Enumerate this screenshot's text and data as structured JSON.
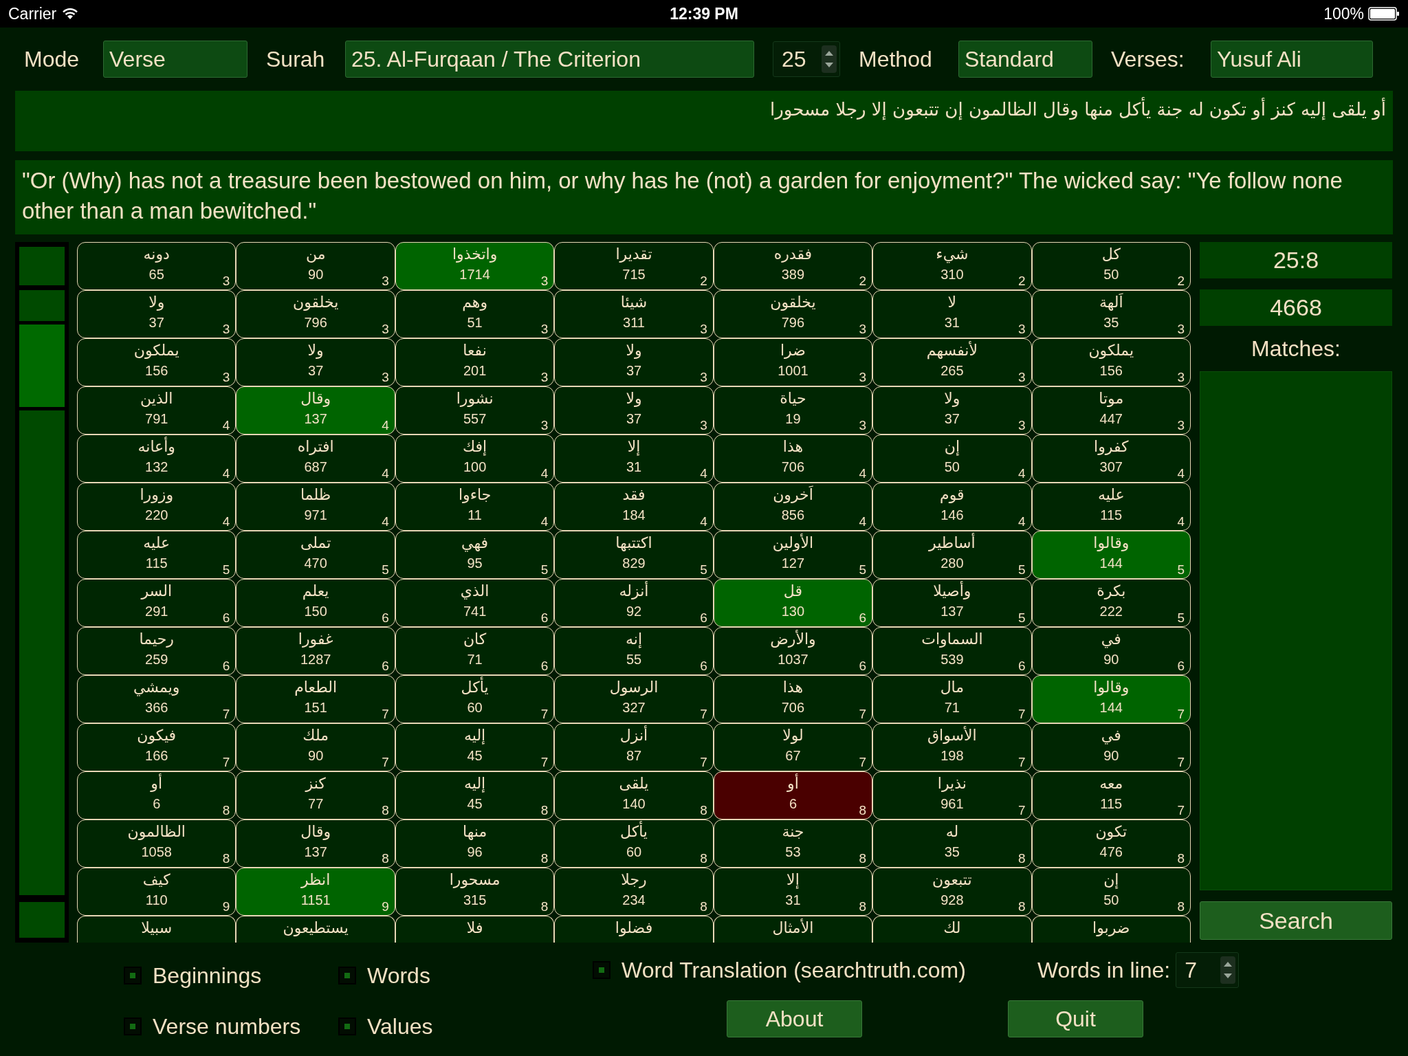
{
  "status_bar": {
    "carrier": "Carrier",
    "time": "12:39 PM",
    "battery": "100%"
  },
  "toolbar": {
    "mode_label": "Mode",
    "mode": "Verse",
    "surah_label": "Surah",
    "surah": "25. Al-Furqaan / The Criterion",
    "surah_number": "25",
    "method_label": "Method",
    "method": "Standard",
    "verses_label": "Verses:",
    "verses": "Yusuf Ali"
  },
  "arabic_verse": "أو يلقى إليه كنز أو تكون له جنة يأكل منها وقال الظالمون إن تتبعون إلا رجلا مسحورا",
  "translation": "\"Or (Why) has not a treasure been bestowed on him, or why has he (not) a garden for enjoyment?\" The wicked say: \"Ye follow none other than a man bewitched.\"",
  "grid": {
    "rows": [
      [
        {
          "word": "كل",
          "value": "50",
          "verse": "2",
          "kind": "plain"
        },
        {
          "word": "شيء",
          "value": "310",
          "verse": "2",
          "kind": "plain"
        },
        {
          "word": "فقدره",
          "value": "389",
          "verse": "2",
          "kind": "plain"
        },
        {
          "word": "تقديرا",
          "value": "715",
          "verse": "2",
          "kind": "plain"
        },
        {
          "word": "واتخذوا",
          "value": "1714",
          "verse": "3",
          "kind": "match"
        },
        {
          "word": "من",
          "value": "90",
          "verse": "3",
          "kind": "plain"
        },
        {
          "word": "دونه",
          "value": "65",
          "verse": "3",
          "kind": "plain"
        }
      ],
      [
        {
          "word": "اَلهة",
          "value": "35",
          "verse": "3",
          "kind": "plain"
        },
        {
          "word": "لا",
          "value": "31",
          "verse": "3",
          "kind": "plain"
        },
        {
          "word": "يخلقون",
          "value": "796",
          "verse": "3",
          "kind": "plain"
        },
        {
          "word": "شيئا",
          "value": "311",
          "verse": "3",
          "kind": "plain"
        },
        {
          "word": "وهم",
          "value": "51",
          "verse": "3",
          "kind": "plain"
        },
        {
          "word": "يخلقون",
          "value": "796",
          "verse": "3",
          "kind": "plain"
        },
        {
          "word": "ولا",
          "value": "37",
          "verse": "3",
          "kind": "plain"
        }
      ],
      [
        {
          "word": "يملكون",
          "value": "156",
          "verse": "3",
          "kind": "plain"
        },
        {
          "word": "لأنفسهم",
          "value": "265",
          "verse": "3",
          "kind": "plain"
        },
        {
          "word": "ضرا",
          "value": "1001",
          "verse": "3",
          "kind": "plain"
        },
        {
          "word": "ولا",
          "value": "37",
          "verse": "3",
          "kind": "plain"
        },
        {
          "word": "نفعا",
          "value": "201",
          "verse": "3",
          "kind": "plain"
        },
        {
          "word": "ولا",
          "value": "37",
          "verse": "3",
          "kind": "plain"
        },
        {
          "word": "يملكون",
          "value": "156",
          "verse": "3",
          "kind": "plain"
        }
      ],
      [
        {
          "word": "موتا",
          "value": "447",
          "verse": "3",
          "kind": "plain"
        },
        {
          "word": "ولا",
          "value": "37",
          "verse": "3",
          "kind": "plain"
        },
        {
          "word": "حياة",
          "value": "19",
          "verse": "3",
          "kind": "plain"
        },
        {
          "word": "ولا",
          "value": "37",
          "verse": "3",
          "kind": "plain"
        },
        {
          "word": "نشورا",
          "value": "557",
          "verse": "3",
          "kind": "plain"
        },
        {
          "word": "وقال",
          "value": "137",
          "verse": "4",
          "kind": "match"
        },
        {
          "word": "الذين",
          "value": "791",
          "verse": "4",
          "kind": "plain"
        }
      ],
      [
        {
          "word": "كفروا",
          "value": "307",
          "verse": "4",
          "kind": "plain"
        },
        {
          "word": "إن",
          "value": "50",
          "verse": "4",
          "kind": "plain"
        },
        {
          "word": "هذا",
          "value": "706",
          "verse": "4",
          "kind": "plain"
        },
        {
          "word": "إلا",
          "value": "31",
          "verse": "4",
          "kind": "plain"
        },
        {
          "word": "إفك",
          "value": "100",
          "verse": "4",
          "kind": "plain"
        },
        {
          "word": "افتراه",
          "value": "687",
          "verse": "4",
          "kind": "plain"
        },
        {
          "word": "وأعانه",
          "value": "132",
          "verse": "4",
          "kind": "plain"
        }
      ],
      [
        {
          "word": "عليه",
          "value": "115",
          "verse": "4",
          "kind": "plain"
        },
        {
          "word": "قوم",
          "value": "146",
          "verse": "4",
          "kind": "plain"
        },
        {
          "word": "اَخرون",
          "value": "856",
          "verse": "4",
          "kind": "plain"
        },
        {
          "word": "فقد",
          "value": "184",
          "verse": "4",
          "kind": "plain"
        },
        {
          "word": "جاءوا",
          "value": "11",
          "verse": "4",
          "kind": "plain"
        },
        {
          "word": "ظلما",
          "value": "971",
          "verse": "4",
          "kind": "plain"
        },
        {
          "word": "وزورا",
          "value": "220",
          "verse": "4",
          "kind": "plain"
        }
      ],
      [
        {
          "word": "وقالوا",
          "value": "144",
          "verse": "5",
          "kind": "match"
        },
        {
          "word": "أساطير",
          "value": "280",
          "verse": "5",
          "kind": "plain"
        },
        {
          "word": "الأولين",
          "value": "127",
          "verse": "5",
          "kind": "plain"
        },
        {
          "word": "اكتتبها",
          "value": "829",
          "verse": "5",
          "kind": "plain"
        },
        {
          "word": "فهي",
          "value": "95",
          "verse": "5",
          "kind": "plain"
        },
        {
          "word": "تملى",
          "value": "470",
          "verse": "5",
          "kind": "plain"
        },
        {
          "word": "عليه",
          "value": "115",
          "verse": "5",
          "kind": "plain"
        }
      ],
      [
        {
          "word": "بكرة",
          "value": "222",
          "verse": "5",
          "kind": "plain"
        },
        {
          "word": "وأصيلا",
          "value": "137",
          "verse": "5",
          "kind": "plain"
        },
        {
          "word": "قل",
          "value": "130",
          "verse": "6",
          "kind": "match"
        },
        {
          "word": "أنزله",
          "value": "92",
          "verse": "6",
          "kind": "plain"
        },
        {
          "word": "الذي",
          "value": "741",
          "verse": "6",
          "kind": "plain"
        },
        {
          "word": "يعلم",
          "value": "150",
          "verse": "6",
          "kind": "plain"
        },
        {
          "word": "السر",
          "value": "291",
          "verse": "6",
          "kind": "plain"
        }
      ],
      [
        {
          "word": "في",
          "value": "90",
          "verse": "6",
          "kind": "plain"
        },
        {
          "word": "السماوات",
          "value": "539",
          "verse": "6",
          "kind": "plain"
        },
        {
          "word": "والأرض",
          "value": "1037",
          "verse": "6",
          "kind": "plain"
        },
        {
          "word": "إنه",
          "value": "55",
          "verse": "6",
          "kind": "plain"
        },
        {
          "word": "كان",
          "value": "71",
          "verse": "6",
          "kind": "plain"
        },
        {
          "word": "غفورا",
          "value": "1287",
          "verse": "6",
          "kind": "plain"
        },
        {
          "word": "رحيما",
          "value": "259",
          "verse": "6",
          "kind": "plain"
        }
      ],
      [
        {
          "word": "وقالوا",
          "value": "144",
          "verse": "7",
          "kind": "match"
        },
        {
          "word": "مال",
          "value": "71",
          "verse": "7",
          "kind": "plain"
        },
        {
          "word": "هذا",
          "value": "706",
          "verse": "7",
          "kind": "plain"
        },
        {
          "word": "الرسول",
          "value": "327",
          "verse": "7",
          "kind": "plain"
        },
        {
          "word": "يأكل",
          "value": "60",
          "verse": "7",
          "kind": "plain"
        },
        {
          "word": "الطعام",
          "value": "151",
          "verse": "7",
          "kind": "plain"
        },
        {
          "word": "ويمشي",
          "value": "366",
          "verse": "7",
          "kind": "plain"
        }
      ],
      [
        {
          "word": "في",
          "value": "90",
          "verse": "7",
          "kind": "plain"
        },
        {
          "word": "الأسواق",
          "value": "198",
          "verse": "7",
          "kind": "plain"
        },
        {
          "word": "لولا",
          "value": "67",
          "verse": "7",
          "kind": "plain"
        },
        {
          "word": "أنزل",
          "value": "87",
          "verse": "7",
          "kind": "plain"
        },
        {
          "word": "إليه",
          "value": "45",
          "verse": "7",
          "kind": "plain"
        },
        {
          "word": "ملك",
          "value": "90",
          "verse": "7",
          "kind": "plain"
        },
        {
          "word": "فيكون",
          "value": "166",
          "verse": "7",
          "kind": "plain"
        }
      ],
      [
        {
          "word": "معه",
          "value": "115",
          "verse": "7",
          "kind": "plain"
        },
        {
          "word": "نذيرا",
          "value": "961",
          "verse": "7",
          "kind": "plain"
        },
        {
          "word": "أو",
          "value": "6",
          "verse": "8",
          "kind": "current"
        },
        {
          "word": "يلقى",
          "value": "140",
          "verse": "8",
          "kind": "plain"
        },
        {
          "word": "إليه",
          "value": "45",
          "verse": "8",
          "kind": "plain"
        },
        {
          "word": "كنز",
          "value": "77",
          "verse": "8",
          "kind": "plain"
        },
        {
          "word": "أو",
          "value": "6",
          "verse": "8",
          "kind": "plain"
        }
      ],
      [
        {
          "word": "تكون",
          "value": "476",
          "verse": "8",
          "kind": "plain"
        },
        {
          "word": "له",
          "value": "35",
          "verse": "8",
          "kind": "plain"
        },
        {
          "word": "جنة",
          "value": "53",
          "verse": "8",
          "kind": "plain"
        },
        {
          "word": "يأكل",
          "value": "60",
          "verse": "8",
          "kind": "plain"
        },
        {
          "word": "منها",
          "value": "96",
          "verse": "8",
          "kind": "plain"
        },
        {
          "word": "وقال",
          "value": "137",
          "verse": "8",
          "kind": "plain"
        },
        {
          "word": "الظالمون",
          "value": "1058",
          "verse": "8",
          "kind": "plain"
        }
      ],
      [
        {
          "word": "إن",
          "value": "50",
          "verse": "8",
          "kind": "plain"
        },
        {
          "word": "تتبعون",
          "value": "928",
          "verse": "8",
          "kind": "plain"
        },
        {
          "word": "إلا",
          "value": "31",
          "verse": "8",
          "kind": "plain"
        },
        {
          "word": "رجلا",
          "value": "234",
          "verse": "8",
          "kind": "plain"
        },
        {
          "word": "مسحورا",
          "value": "315",
          "verse": "8",
          "kind": "plain"
        },
        {
          "word": "انظر",
          "value": "1151",
          "verse": "9",
          "kind": "match"
        },
        {
          "word": "كيف",
          "value": "110",
          "verse": "9",
          "kind": "plain"
        }
      ]
    ],
    "partial_row": [
      "ضربوا",
      "لك",
      "الأمثال",
      "فضلوا",
      "فلا",
      "يستطيعون",
      "سبيلا"
    ]
  },
  "side_panel": {
    "reference": "25:8",
    "total": "4668",
    "matches_label": "Matches:",
    "search_button": "Search"
  },
  "options": {
    "beginnings": {
      "label": "Beginnings",
      "checked": true
    },
    "words": {
      "label": "Words",
      "checked": true
    },
    "word_translation": {
      "label": "Word Translation (searchtruth.com)",
      "checked": true
    },
    "verse_numbers": {
      "label": "Verse numbers",
      "checked": true
    },
    "values": {
      "label": "Values",
      "checked": true
    }
  },
  "words_in_line": {
    "label": "Words in line:",
    "value": "7"
  },
  "about_button": "About",
  "quit_button": "Quit"
}
